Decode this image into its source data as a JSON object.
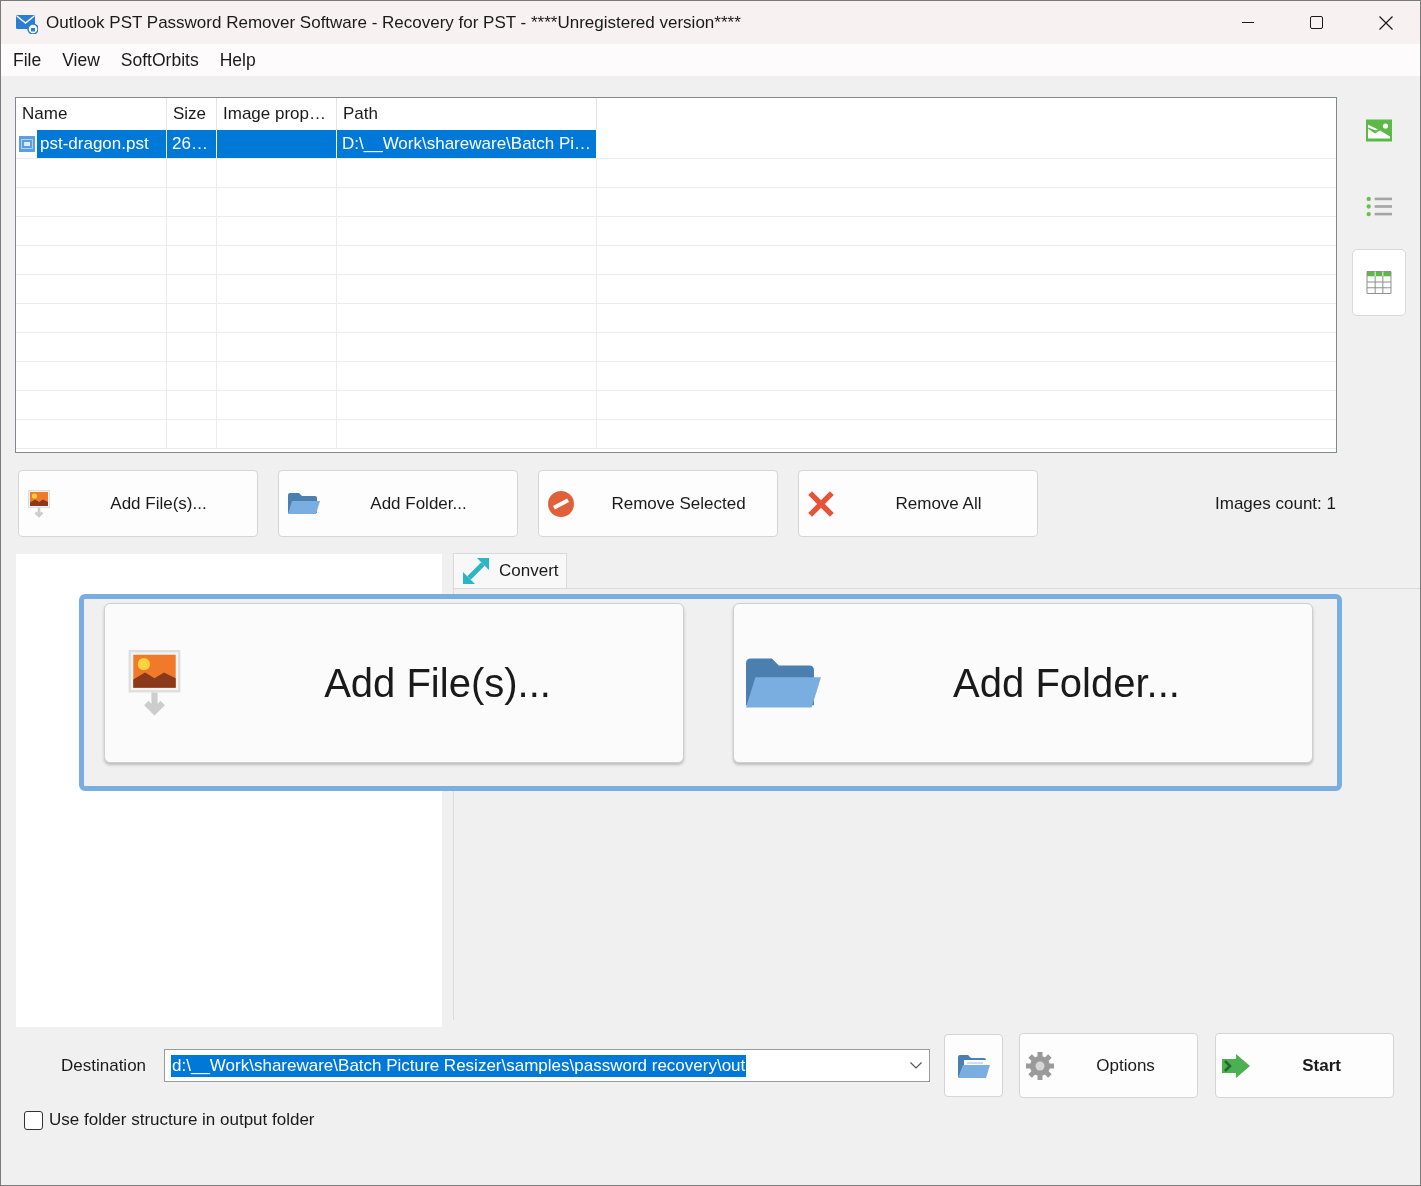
{
  "window": {
    "title": "Outlook PST Password Remover Software - Recovery for PST - ****Unregistered version****"
  },
  "menu": [
    {
      "label": "File"
    },
    {
      "label": "View"
    },
    {
      "label": "SoftOrbits"
    },
    {
      "label": "Help"
    }
  ],
  "file_table": {
    "columns": [
      {
        "label": "Name"
      },
      {
        "label": "Size"
      },
      {
        "label": "Image prop…"
      },
      {
        "label": "Path"
      }
    ],
    "rows": [
      {
        "name": "pst-dragon.pst",
        "size": "26…",
        "path": "D:\\__Work\\shareware\\Batch Pi…",
        "selected": true
      }
    ]
  },
  "view_toolbar": [
    {
      "kind": "thumbnails",
      "selected": false
    },
    {
      "kind": "list",
      "selected": false
    },
    {
      "kind": "details",
      "selected": true
    }
  ],
  "file_buttons": [
    {
      "kind": "add_files",
      "label": "Add File(s)..."
    },
    {
      "kind": "add_folder",
      "label": "Add Folder..."
    },
    {
      "kind": "remove_selected",
      "label": "Remove Selected"
    },
    {
      "kind": "remove_all",
      "label": "Remove All"
    }
  ],
  "images_count": "Images count: 1",
  "tabs": [
    {
      "label": "Convert",
      "selected": true
    }
  ],
  "drop_zone": {
    "buttons": [
      {
        "kind": "add_files",
        "label": "Add File(s)..."
      },
      {
        "kind": "add_folder",
        "label": "Add Folder..."
      }
    ]
  },
  "destination": {
    "label": "Destination",
    "value": "d:\\__Work\\shareware\\Batch Picture Resizer\\samples\\password recovery\\out",
    "text_selected": true
  },
  "actions": [
    {
      "kind": "browse"
    },
    {
      "kind": "options",
      "label": "Options"
    },
    {
      "kind": "start",
      "label": "Start"
    }
  ],
  "options": [
    {
      "label": "Use folder structure in output folder",
      "checked": false
    }
  ]
}
